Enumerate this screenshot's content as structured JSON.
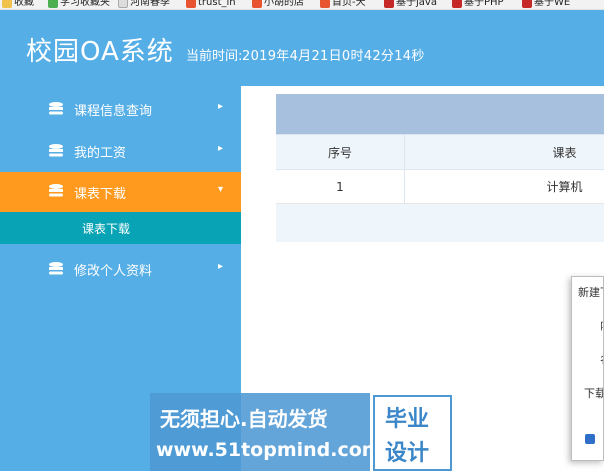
{
  "bookmarks": [
    {
      "label": "收藏"
    },
    {
      "label": "学习收藏夹"
    },
    {
      "label": "河南春季"
    },
    {
      "label": "trust_in"
    },
    {
      "label": "小胡的店"
    },
    {
      "label": "首页-天"
    },
    {
      "label": "基于java"
    },
    {
      "label": "基于PHP"
    },
    {
      "label": "基于WE"
    }
  ],
  "header": {
    "title": "校园OA系统",
    "time_label": "当前时间:",
    "time_value": "2019年4月21日0时42分14秒"
  },
  "sidebar": {
    "items": [
      {
        "label": "课程信息查询",
        "arrow": "▸"
      },
      {
        "label": "我的工资",
        "arrow": "▸"
      },
      {
        "label": "课表下载",
        "arrow": "▾"
      },
      {
        "label": "修改个人资料",
        "arrow": "▸"
      }
    ],
    "sub_item": {
      "label": "课表下载"
    }
  },
  "table": {
    "headers": [
      "序号",
      "课表"
    ],
    "rows": [
      [
        "1",
        "计算机"
      ]
    ]
  },
  "dialog": {
    "title": "新建下",
    "rows": [
      "内",
      "名",
      "下载"
    ]
  },
  "watermark": {
    "line1": "无须担心.自动发货",
    "line2": "www.51topmind.com",
    "right1": "毕业",
    "right2": "设计"
  },
  "colors": {
    "header_bg": "#56aee6",
    "sidebar_bg": "#56aee6",
    "active_bg": "#ff9a1f",
    "sub_bg": "#08a3b4",
    "panel_head_bg": "#a6c0dd"
  }
}
